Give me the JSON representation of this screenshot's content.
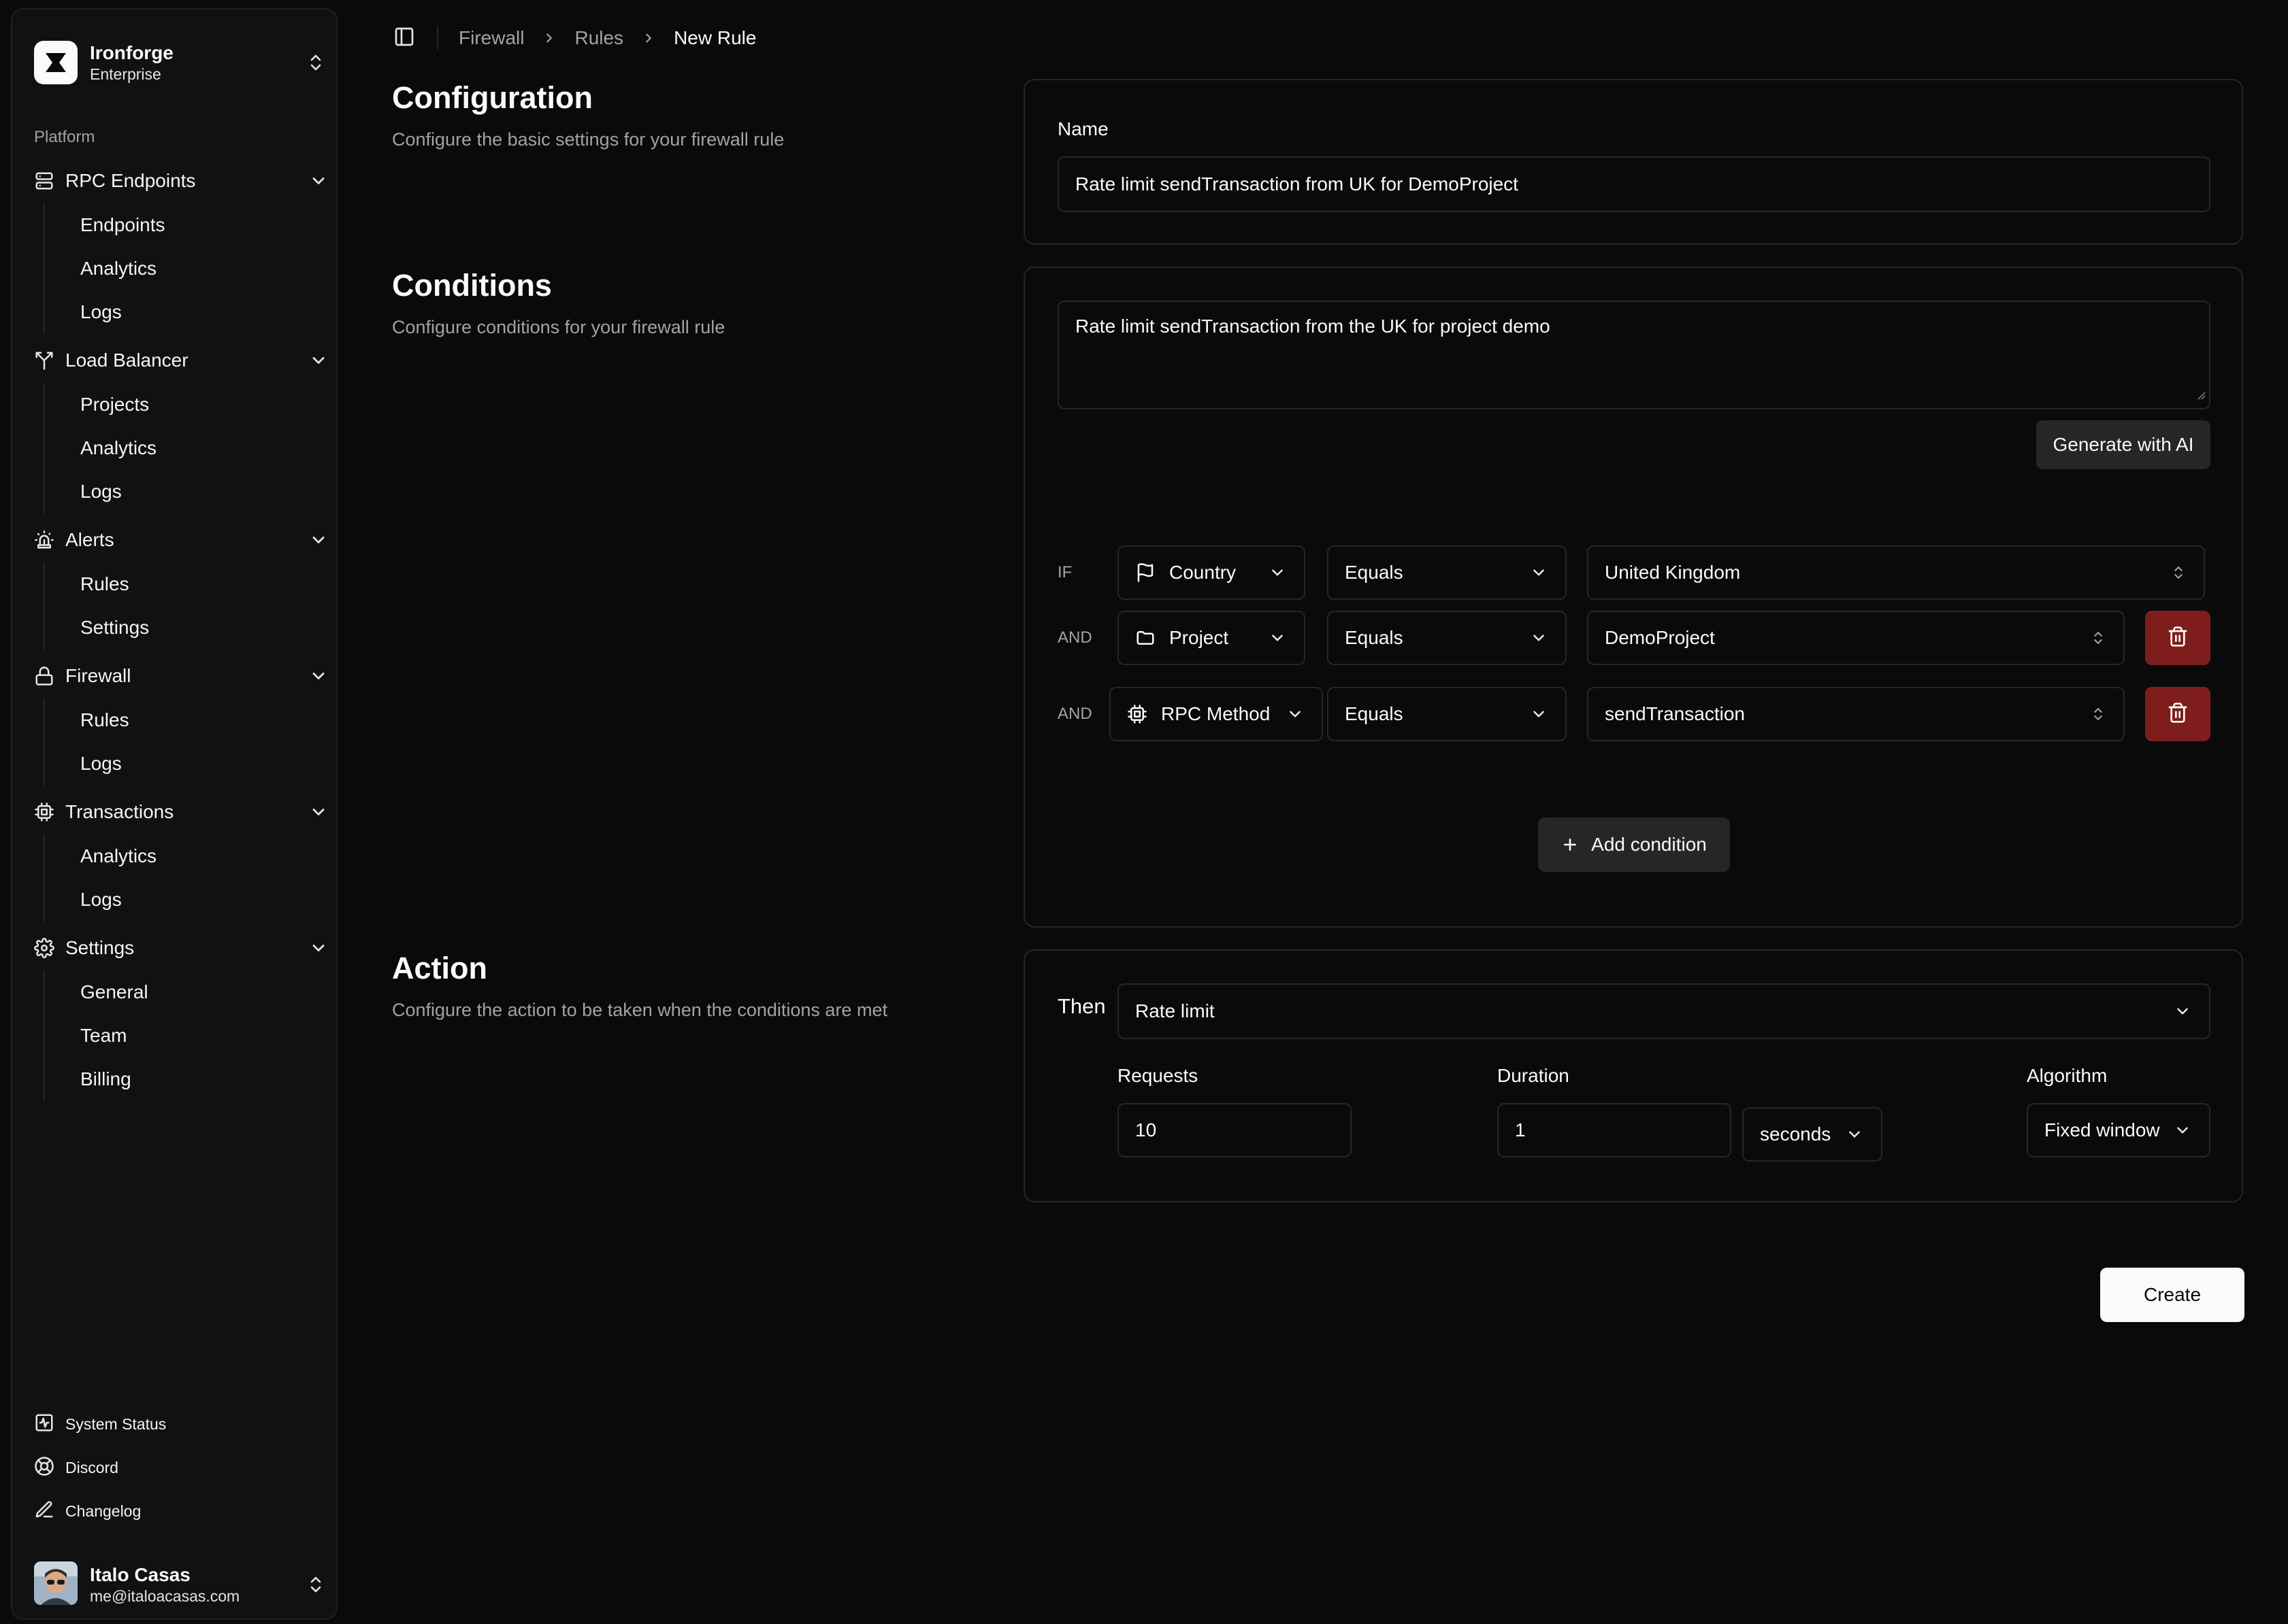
{
  "sidebar": {
    "brand": {
      "name": "Ironforge",
      "plan": "Enterprise"
    },
    "group_label": "Platform",
    "sections": [
      {
        "label": "RPC Endpoints",
        "icon": "server-icon",
        "items": [
          "Endpoints",
          "Analytics",
          "Logs"
        ]
      },
      {
        "label": "Load Balancer",
        "icon": "split-icon",
        "items": [
          "Projects",
          "Analytics",
          "Logs"
        ]
      },
      {
        "label": "Alerts",
        "icon": "siren-icon",
        "items": [
          "Rules",
          "Settings"
        ]
      },
      {
        "label": "Firewall",
        "icon": "lock-icon",
        "items": [
          "Rules",
          "Logs"
        ]
      },
      {
        "label": "Transactions",
        "icon": "cpu-icon",
        "items": [
          "Analytics",
          "Logs"
        ]
      },
      {
        "label": "Settings",
        "icon": "gear-icon",
        "items": [
          "General",
          "Team",
          "Billing"
        ]
      }
    ],
    "footer": [
      {
        "label": "System Status",
        "icon": "activity-icon"
      },
      {
        "label": "Discord",
        "icon": "lifebuoy-icon"
      },
      {
        "label": "Changelog",
        "icon": "pen-icon"
      }
    ],
    "user": {
      "name": "Italo Casas",
      "email": "me@italoacasas.com"
    }
  },
  "breadcrumb": [
    "Firewall",
    "Rules",
    "New Rule"
  ],
  "configuration": {
    "title": "Configuration",
    "description": "Configure the basic settings for your firewall rule",
    "name_label": "Name",
    "name_value": "Rate limit sendTransaction from UK for DemoProject"
  },
  "conditions": {
    "title": "Conditions",
    "description": "Configure conditions for your firewall rule",
    "prompt": "Rate limit sendTransaction from the UK for project demo",
    "generate_label": "Generate with AI",
    "rows": [
      {
        "keyword": "IF",
        "field": "Country",
        "field_icon": "flag-icon",
        "operator": "Equals",
        "value": "United Kingdom"
      },
      {
        "keyword": "AND",
        "field": "Project",
        "field_icon": "folder-icon",
        "operator": "Equals",
        "value": "DemoProject"
      },
      {
        "keyword": "AND",
        "field": "RPC Method",
        "field_icon": "cpu-icon",
        "operator": "Equals",
        "value": "sendTransaction"
      }
    ],
    "add_label": "Add condition"
  },
  "action": {
    "title": "Action",
    "description": "Configure the action to be taken when the conditions are met",
    "then_label": "Then",
    "then_value": "Rate limit",
    "requests_label": "Requests",
    "requests_value": "10",
    "duration_label": "Duration",
    "duration_value": "1",
    "duration_unit": "seconds",
    "algorithm_label": "Algorithm",
    "algorithm_value": "Fixed window"
  },
  "create_label": "Create",
  "colors": {
    "background": "#0a0a0a",
    "sidebar": "#111111",
    "border": "#262626",
    "danger": "#7f1d1d",
    "muted_text": "#a3a3a3"
  }
}
